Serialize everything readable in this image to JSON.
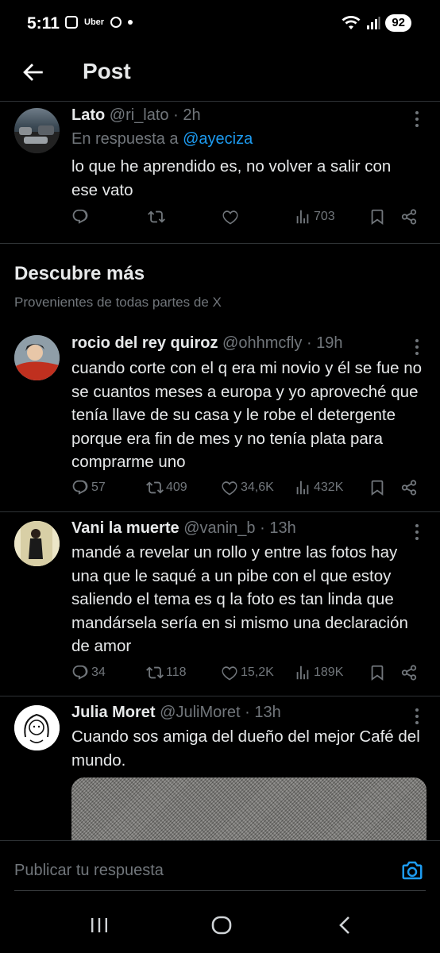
{
  "status_bar": {
    "time": "5:11",
    "app_label": "Uber",
    "battery": "92"
  },
  "header": {
    "title": "Post"
  },
  "reply_tweet": {
    "name": "Lato",
    "handle": "@ri_lato",
    "time": "· 2h",
    "reply_prefix": "En respuesta a",
    "reply_to": "@ayeciza",
    "text": "lo que he aprendido es, no volver a salir con ese vato",
    "views": "703"
  },
  "discover": {
    "title": "Descubre más",
    "subtitle": "Provenientes de todas partes de X"
  },
  "tweets": [
    {
      "name": "rocio del rey quiroz",
      "handle": "@ohhmcfly",
      "time": "· 19h",
      "text": "cuando corte con el q era mi novio y él se fue no se cuantos meses a europa y yo aproveché que tenía llave de su casa y le robe el detergente porque era fin de mes y no tenía plata para comprarme uno",
      "replies": "57",
      "reposts": "409",
      "likes": "34,6K",
      "views": "432K"
    },
    {
      "name": "Vani la muerte",
      "handle": "@vanin_b",
      "time": "· 13h",
      "text": "mandé a revelar un rollo y entre las fotos hay una que le saqué a un pibe con el que estoy saliendo el tema es q la foto es tan linda que mandársela sería en si mismo una declaración de amor",
      "replies": "34",
      "reposts": "118",
      "likes": "15,2K",
      "views": "189K"
    },
    {
      "name": "Julia Moret",
      "handle": "@JuliMoret",
      "time": "· 13h",
      "text": "Cuando sos amiga del dueño del mejor Café del mundo."
    }
  ],
  "reply_bar": {
    "placeholder": "Publicar tu respuesta"
  },
  "colors": {
    "background": "#000000",
    "text": "#e7e9ea",
    "muted": "#71767b",
    "accent": "#1d9bf0",
    "divider": "#2f3336"
  },
  "icons": [
    "back-arrow-icon",
    "more-icon",
    "reply-icon",
    "repost-icon",
    "like-icon",
    "views-icon",
    "bookmark-icon",
    "share-icon",
    "camera-icon",
    "recents-icon",
    "home-icon",
    "back-icon"
  ]
}
